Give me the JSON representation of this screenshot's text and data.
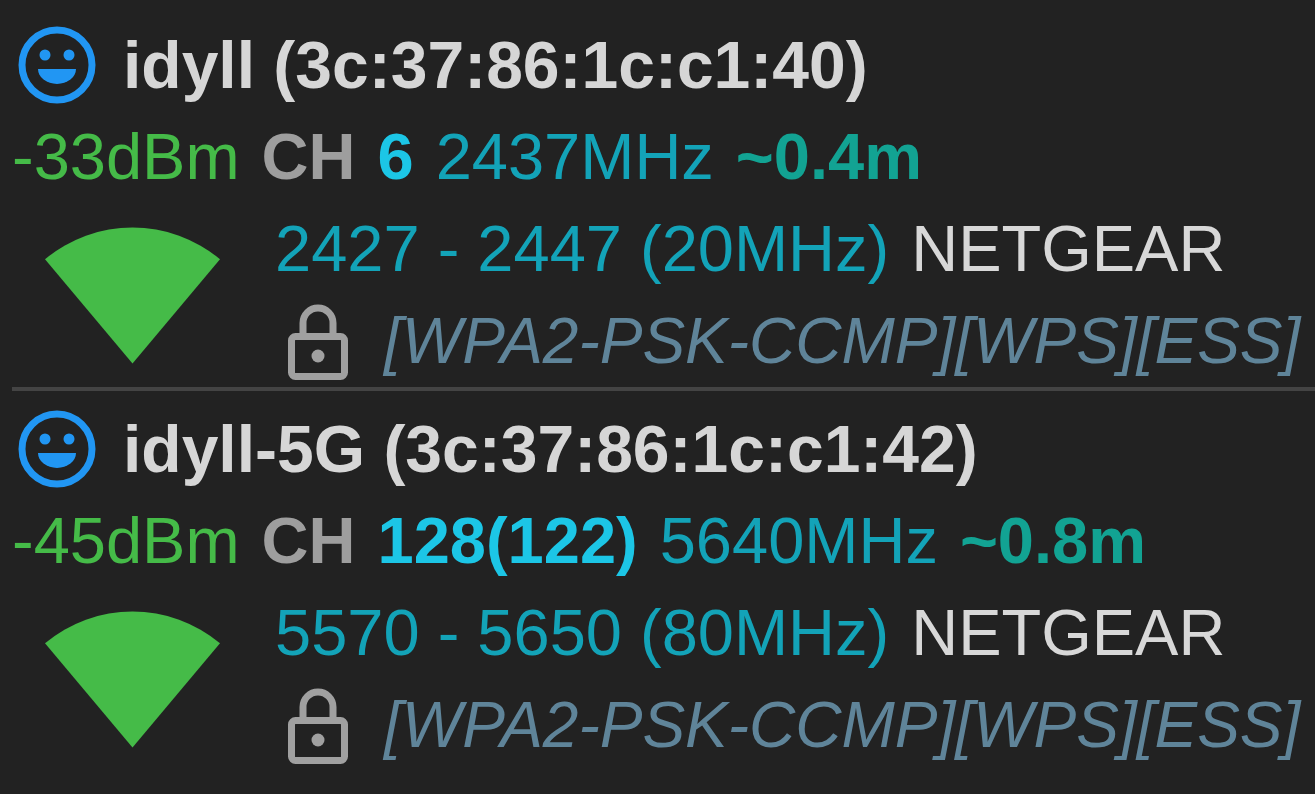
{
  "networks": [
    {
      "title": "idyll (3c:37:86:1c:c1:40)",
      "signal": "-33dBm",
      "channel_label": "CH",
      "channel": "6",
      "frequency": "2437MHz",
      "distance": "~0.4m",
      "range": "2427 - 2447 (20MHz)",
      "vendor": "NETGEAR",
      "capabilities": "[WPA2-PSK-CCMP][WPS][ESS]"
    },
    {
      "title": "idyll-5G (3c:37:86:1c:c1:42)",
      "signal": "-45dBm",
      "channel_label": "CH",
      "channel": "128(122)",
      "frequency": "5640MHz",
      "distance": "~0.8m",
      "range": "5570 - 5650 (80MHz)",
      "vendor": "NETGEAR",
      "capabilities": "[WPA2-PSK-CCMP][WPS][ESS]"
    }
  ]
}
